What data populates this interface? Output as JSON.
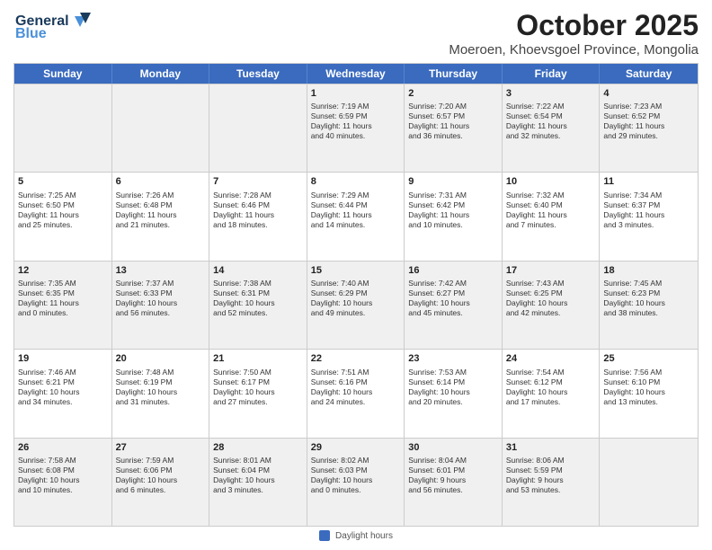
{
  "header": {
    "logo_line1": "General",
    "logo_line2": "Blue",
    "main_title": "October 2025",
    "subtitle": "Moeroen, Khoevsgoel Province, Mongolia"
  },
  "days_of_week": [
    "Sunday",
    "Monday",
    "Tuesday",
    "Wednesday",
    "Thursday",
    "Friday",
    "Saturday"
  ],
  "footer_label": "Daylight hours",
  "weeks": [
    [
      {
        "day": "",
        "info": ""
      },
      {
        "day": "",
        "info": ""
      },
      {
        "day": "",
        "info": ""
      },
      {
        "day": "1",
        "info": "Sunrise: 7:19 AM\nSunset: 6:59 PM\nDaylight: 11 hours\nand 40 minutes."
      },
      {
        "day": "2",
        "info": "Sunrise: 7:20 AM\nSunset: 6:57 PM\nDaylight: 11 hours\nand 36 minutes."
      },
      {
        "day": "3",
        "info": "Sunrise: 7:22 AM\nSunset: 6:54 PM\nDaylight: 11 hours\nand 32 minutes."
      },
      {
        "day": "4",
        "info": "Sunrise: 7:23 AM\nSunset: 6:52 PM\nDaylight: 11 hours\nand 29 minutes."
      }
    ],
    [
      {
        "day": "5",
        "info": "Sunrise: 7:25 AM\nSunset: 6:50 PM\nDaylight: 11 hours\nand 25 minutes."
      },
      {
        "day": "6",
        "info": "Sunrise: 7:26 AM\nSunset: 6:48 PM\nDaylight: 11 hours\nand 21 minutes."
      },
      {
        "day": "7",
        "info": "Sunrise: 7:28 AM\nSunset: 6:46 PM\nDaylight: 11 hours\nand 18 minutes."
      },
      {
        "day": "8",
        "info": "Sunrise: 7:29 AM\nSunset: 6:44 PM\nDaylight: 11 hours\nand 14 minutes."
      },
      {
        "day": "9",
        "info": "Sunrise: 7:31 AM\nSunset: 6:42 PM\nDaylight: 11 hours\nand 10 minutes."
      },
      {
        "day": "10",
        "info": "Sunrise: 7:32 AM\nSunset: 6:40 PM\nDaylight: 11 hours\nand 7 minutes."
      },
      {
        "day": "11",
        "info": "Sunrise: 7:34 AM\nSunset: 6:37 PM\nDaylight: 11 hours\nand 3 minutes."
      }
    ],
    [
      {
        "day": "12",
        "info": "Sunrise: 7:35 AM\nSunset: 6:35 PM\nDaylight: 11 hours\nand 0 minutes."
      },
      {
        "day": "13",
        "info": "Sunrise: 7:37 AM\nSunset: 6:33 PM\nDaylight: 10 hours\nand 56 minutes."
      },
      {
        "day": "14",
        "info": "Sunrise: 7:38 AM\nSunset: 6:31 PM\nDaylight: 10 hours\nand 52 minutes."
      },
      {
        "day": "15",
        "info": "Sunrise: 7:40 AM\nSunset: 6:29 PM\nDaylight: 10 hours\nand 49 minutes."
      },
      {
        "day": "16",
        "info": "Sunrise: 7:42 AM\nSunset: 6:27 PM\nDaylight: 10 hours\nand 45 minutes."
      },
      {
        "day": "17",
        "info": "Sunrise: 7:43 AM\nSunset: 6:25 PM\nDaylight: 10 hours\nand 42 minutes."
      },
      {
        "day": "18",
        "info": "Sunrise: 7:45 AM\nSunset: 6:23 PM\nDaylight: 10 hours\nand 38 minutes."
      }
    ],
    [
      {
        "day": "19",
        "info": "Sunrise: 7:46 AM\nSunset: 6:21 PM\nDaylight: 10 hours\nand 34 minutes."
      },
      {
        "day": "20",
        "info": "Sunrise: 7:48 AM\nSunset: 6:19 PM\nDaylight: 10 hours\nand 31 minutes."
      },
      {
        "day": "21",
        "info": "Sunrise: 7:50 AM\nSunset: 6:17 PM\nDaylight: 10 hours\nand 27 minutes."
      },
      {
        "day": "22",
        "info": "Sunrise: 7:51 AM\nSunset: 6:16 PM\nDaylight: 10 hours\nand 24 minutes."
      },
      {
        "day": "23",
        "info": "Sunrise: 7:53 AM\nSunset: 6:14 PM\nDaylight: 10 hours\nand 20 minutes."
      },
      {
        "day": "24",
        "info": "Sunrise: 7:54 AM\nSunset: 6:12 PM\nDaylight: 10 hours\nand 17 minutes."
      },
      {
        "day": "25",
        "info": "Sunrise: 7:56 AM\nSunset: 6:10 PM\nDaylight: 10 hours\nand 13 minutes."
      }
    ],
    [
      {
        "day": "26",
        "info": "Sunrise: 7:58 AM\nSunset: 6:08 PM\nDaylight: 10 hours\nand 10 minutes."
      },
      {
        "day": "27",
        "info": "Sunrise: 7:59 AM\nSunset: 6:06 PM\nDaylight: 10 hours\nand 6 minutes."
      },
      {
        "day": "28",
        "info": "Sunrise: 8:01 AM\nSunset: 6:04 PM\nDaylight: 10 hours\nand 3 minutes."
      },
      {
        "day": "29",
        "info": "Sunrise: 8:02 AM\nSunset: 6:03 PM\nDaylight: 10 hours\nand 0 minutes."
      },
      {
        "day": "30",
        "info": "Sunrise: 8:04 AM\nSunset: 6:01 PM\nDaylight: 9 hours\nand 56 minutes."
      },
      {
        "day": "31",
        "info": "Sunrise: 8:06 AM\nSunset: 5:59 PM\nDaylight: 9 hours\nand 53 minutes."
      },
      {
        "day": "",
        "info": ""
      }
    ]
  ]
}
